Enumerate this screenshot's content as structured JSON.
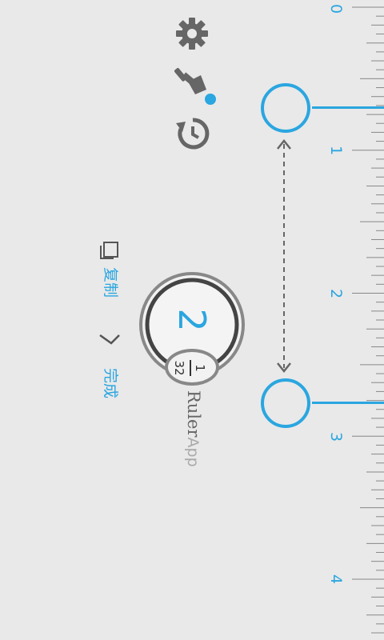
{
  "ruler": {
    "numbers": [
      "0",
      "1",
      "2",
      "3",
      "4"
    ],
    "accent_color": "#2aa6e0"
  },
  "measurement": {
    "integer": "2",
    "fraction_numerator": "1",
    "fraction_denominator": "32"
  },
  "brand": {
    "name_part1": "Ruler",
    "name_part2": "App"
  },
  "actions": {
    "copy_label": "复制",
    "done_label": "完成"
  },
  "toolbar": {
    "icons": [
      "settings-icon",
      "brush-icon",
      "reset-icon"
    ]
  }
}
